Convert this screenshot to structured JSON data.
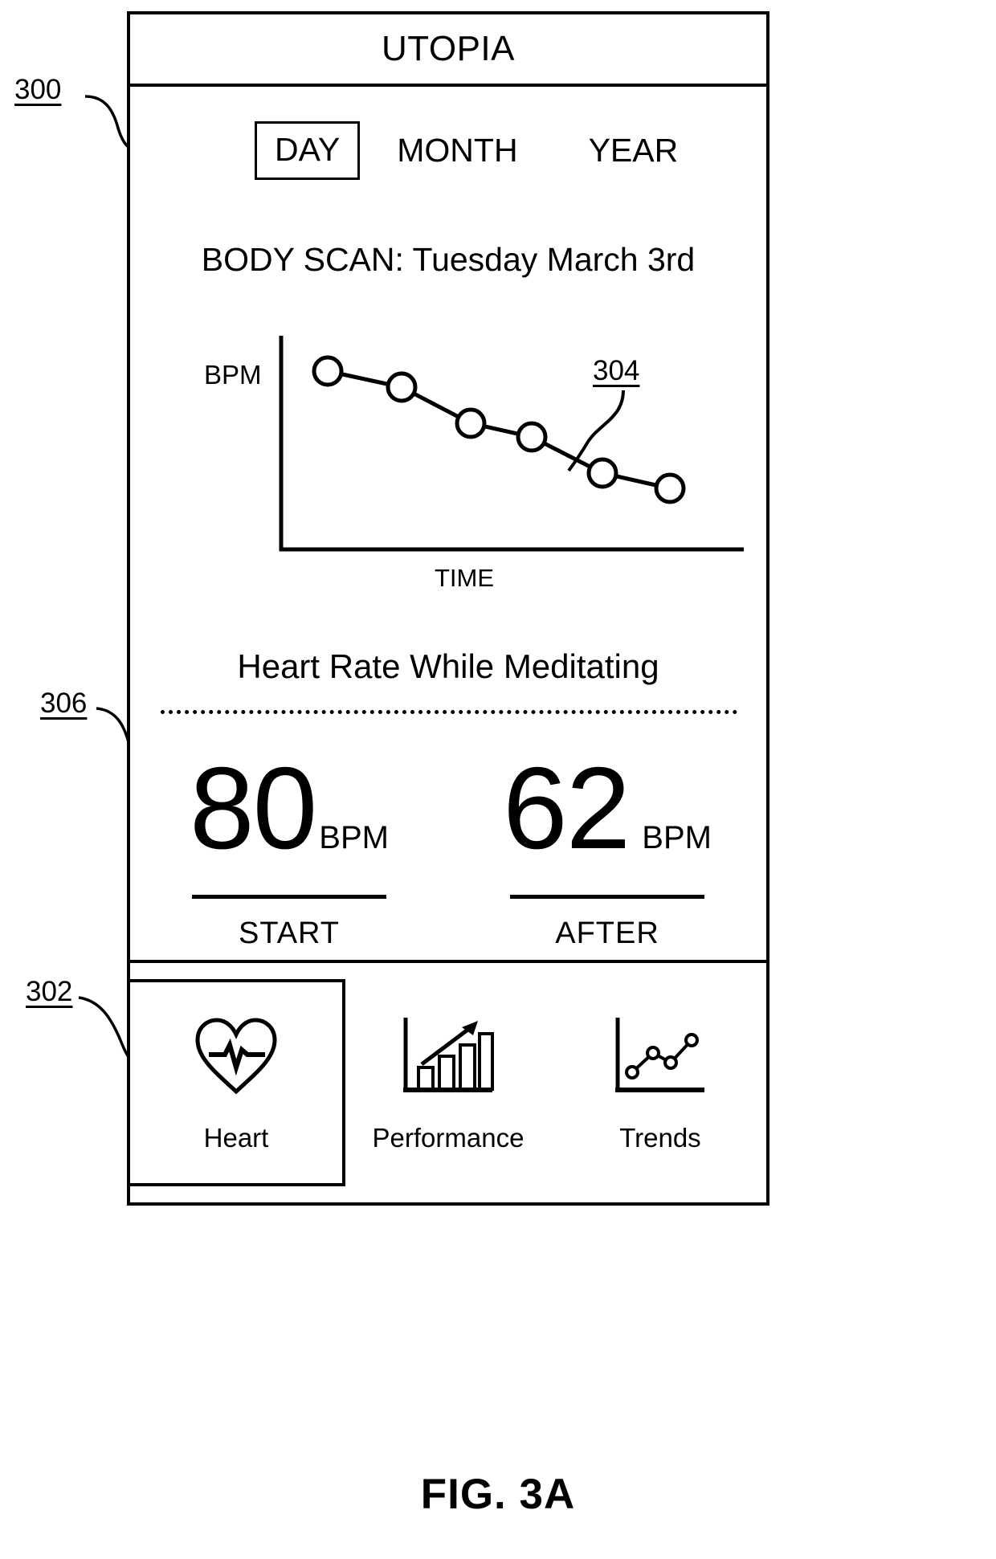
{
  "figure": {
    "caption": "FIG. 3A",
    "reference_numerals": {
      "device": "300",
      "nav_bar": "302",
      "chart_line": "304",
      "stats_section": "306"
    }
  },
  "app": {
    "title": "UTOPIA"
  },
  "tabs": [
    {
      "label": "DAY",
      "selected": true
    },
    {
      "label": "MONTH",
      "selected": false
    },
    {
      "label": "YEAR",
      "selected": false
    }
  ],
  "scan": {
    "heading": "BODY SCAN: Tuesday March 3rd"
  },
  "chart_data": {
    "type": "line",
    "title": "",
    "subtitle": "Heart Rate While Meditating",
    "xlabel": "TIME",
    "ylabel": "BPM",
    "grid": false,
    "legend": false,
    "x": [
      1,
      2,
      3,
      4,
      5,
      6
    ],
    "values": [
      80,
      76,
      71,
      68,
      64,
      62
    ],
    "ylim": [
      55,
      85
    ],
    "marker": "open-circle",
    "annotation": "304"
  },
  "stats": [
    {
      "value": "80",
      "unit": "BPM",
      "label": "START"
    },
    {
      "value": "62",
      "unit": "BPM",
      "label": "AFTER"
    }
  ],
  "nav": [
    {
      "label": "Heart",
      "icon": "heart-pulse-icon",
      "selected": true
    },
    {
      "label": "Performance",
      "icon": "bar-chart-arrow-icon",
      "selected": false
    },
    {
      "label": "Trends",
      "icon": "line-chart-icon",
      "selected": false
    }
  ]
}
